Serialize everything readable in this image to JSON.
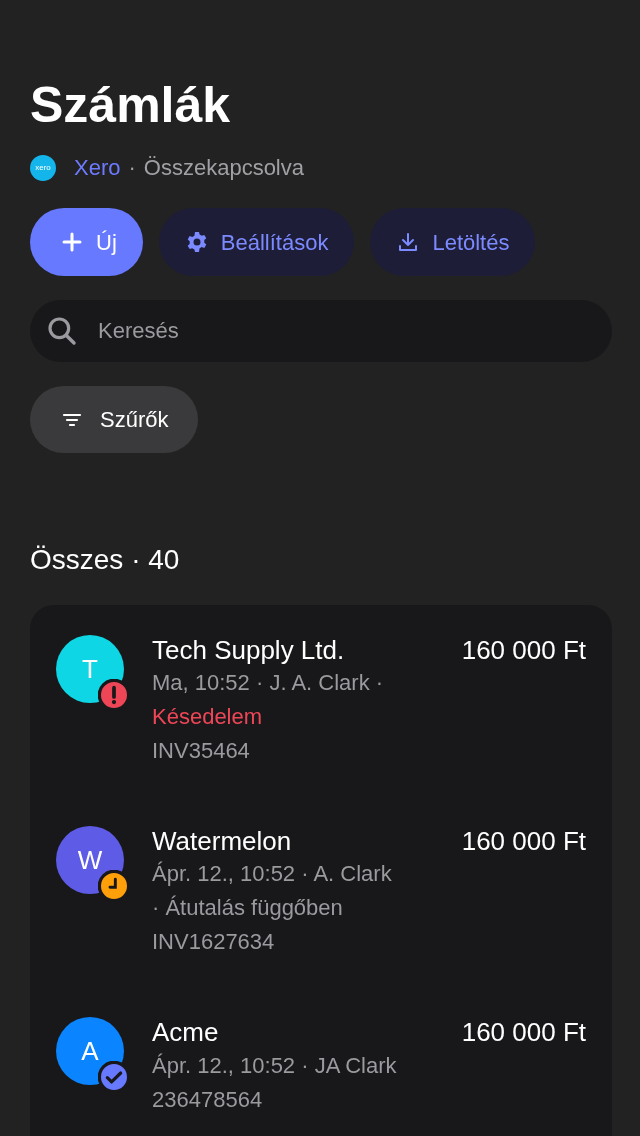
{
  "title": "Számlák",
  "integration": {
    "logo_text": "xero",
    "name": "Xero",
    "separator": "·",
    "status": "Összekapcsolva"
  },
  "actions": [
    {
      "kind": "add",
      "label": "Új"
    },
    {
      "kind": "settings",
      "label": "Beállítások"
    },
    {
      "kind": "download",
      "label": "Letöltés"
    }
  ],
  "search": {
    "placeholder": "Keresés"
  },
  "filter_button": {
    "label": "Szűrők"
  },
  "section_heading": "Összes · 40",
  "invoices": [
    {
      "initial": "T",
      "color": "#0fd6e4",
      "kind": "overdue",
      "name": "Tech Supply Ltd.",
      "amount": "160 000 Ft",
      "meta": "Ma, 10:52 · J. A. Clark ·",
      "status": "Késedelem",
      "number": "INV35464"
    },
    {
      "initial": "W",
      "color": "#5e5ce6",
      "kind": "pending",
      "name": "Watermelon",
      "amount": "160 000 Ft",
      "meta": "Ápr. 12., 10:52 · A. Clark",
      "status": "· Átutalás függőben",
      "number": "INV1627634"
    },
    {
      "initial": "A",
      "color": "#0a84ff",
      "kind": "paid",
      "name": "Acme",
      "amount": "160 000 Ft",
      "meta": "Ápr. 12., 10:52 · JA Clark",
      "number": "236478564"
    }
  ]
}
